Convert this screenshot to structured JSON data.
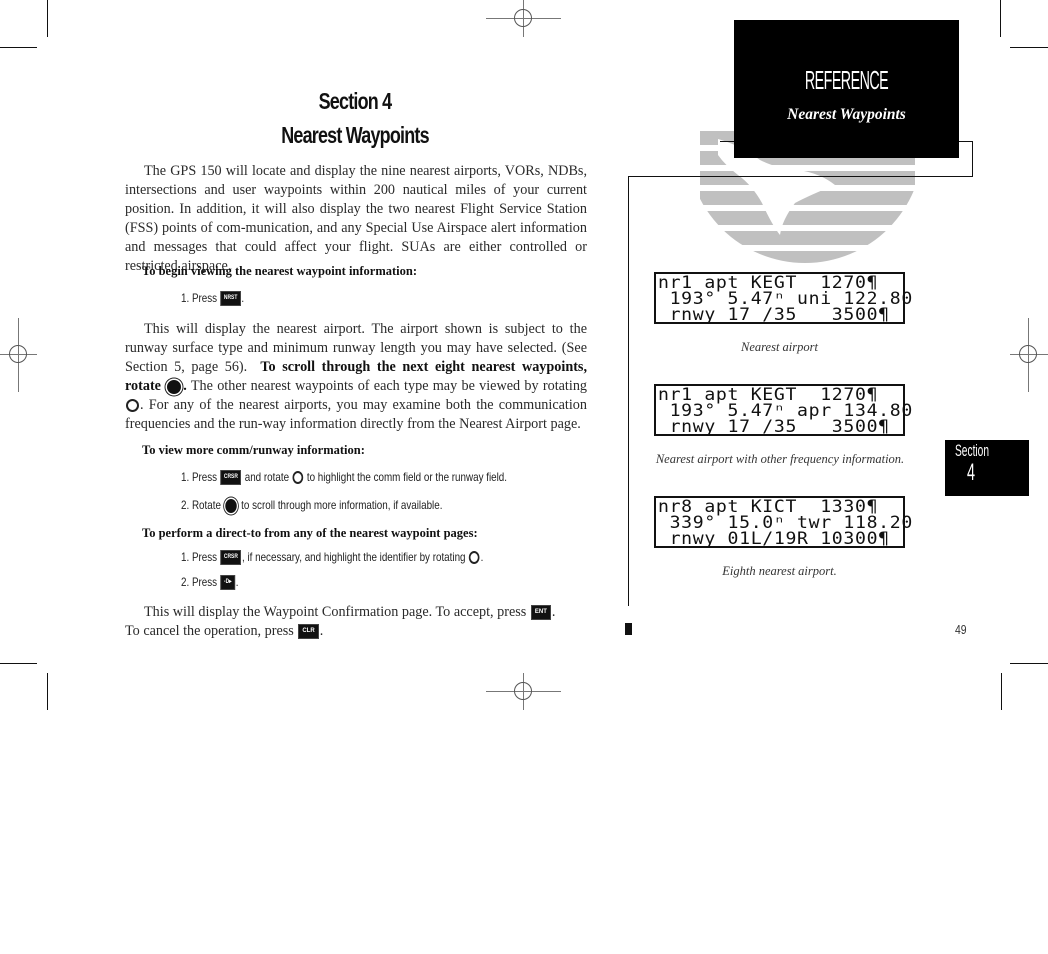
{
  "heading": {
    "section": "Section 4",
    "title": "Nearest Waypoints"
  },
  "intro_paragraph": "The GPS 150 will locate and display the nine nearest airports, VORs, NDBs, intersections and user waypoints within 200 nautical miles of your current position. In addition, it will also display the two nearest Flight Service Station (FSS) points of com-munication, and any Special Use Airspace alert information and messages that could affect your flight. SUAs are either controlled or restricted airspace.",
  "begin_viewing": {
    "subhead": "To begin viewing the nearest waypoint information:",
    "step1_prefix": "1. Press",
    "step1_key": "NRST",
    "step1_suffix": "."
  },
  "para2": {
    "text_a": "This will display the nearest airport. The airport shown is subject to the runway surface type and minimum runway length you may have selected. (See Section 5, page 56).",
    "bold": "To scroll through the next eight nearest waypoints, rotate",
    "bold_end": ".",
    "text_b": "The other nearest waypoints of each type may be viewed by rotating",
    "text_c": ". For any of the nearest airports, you may examine both the communication frequencies and the run-way information directly from the Nearest Airport page."
  },
  "comm_runway": {
    "subhead": "To view more comm/runway information:",
    "step1_prefix": "1. Press",
    "step1_key": "CRSR",
    "step1_mid": "and rotate",
    "step1_suffix": "to highlight the comm field or the runway field.",
    "step2_prefix": "2. Rotate",
    "step2_suffix": "to scroll through more information, if available."
  },
  "direct_to": {
    "subhead": "To perform a direct-to from any of the nearest waypoint pages:",
    "step1_prefix": "1. Press",
    "step1_key": "CRSR",
    "step1_suffix": ", if necessary, and highlight the identifier by rotating",
    "step1_end": ".",
    "step2_prefix": "2. Press",
    "step2_key": "-D▸",
    "step2_suffix": "."
  },
  "confirm_para": {
    "text_a": "This will display the Waypoint Confirmation page. To accept, press",
    "key_accept": "ENT",
    "text_b": ".",
    "text_c": "To cancel the operation, press",
    "key_cancel": "CLR",
    "text_d": "."
  },
  "reference_box": {
    "title": "REFERENCE",
    "subtitle": "Nearest Waypoints"
  },
  "lcd_screens": [
    {
      "rows": [
        "nr1 apt KEGT  1270¶",
        " 193° 5.47ⁿ uni 122.80",
        " rnwy 17 /35   3500¶"
      ],
      "caption": "Nearest airport"
    },
    {
      "rows": [
        "nr1 apt KEGT  1270¶",
        " 193° 5.47ⁿ apr 134.80",
        " rnwy 17 /35   3500¶"
      ],
      "caption": "Nearest airport with other frequency information."
    },
    {
      "rows": [
        "nr8 apt KICT  1330¶",
        " 339° 15.0ⁿ twr 118.20",
        " rnwy 01L/19R 10300¶"
      ],
      "caption": "Eighth nearest airport."
    }
  ],
  "section_tab": {
    "label": "Section",
    "number": "4"
  },
  "page_number": "49",
  "icons": {
    "outer_knob": "outer-knob-icon",
    "inner_knob": "inner-knob-icon",
    "logo": "globe-logo-icon"
  },
  "colors": {
    "logo_gray": "#c0c0c0",
    "ink": "#111111"
  }
}
